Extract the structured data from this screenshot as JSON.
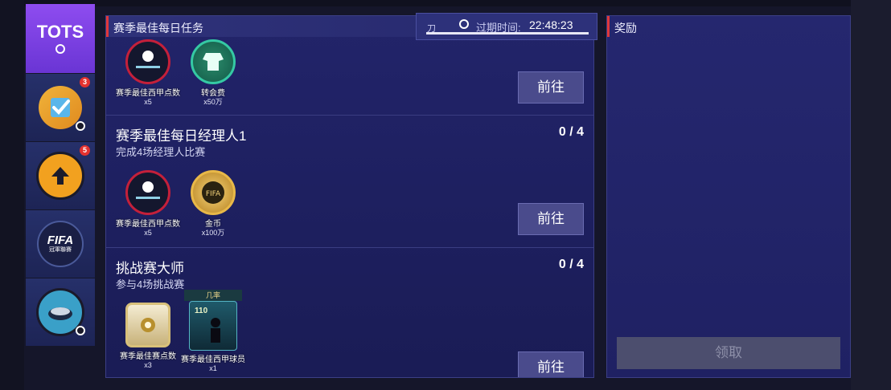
{
  "nav": {
    "items": [
      {
        "label": "TOTS",
        "badge": ""
      },
      {
        "label": "",
        "badge": "3"
      },
      {
        "label": "",
        "badge": "5"
      },
      {
        "label": "FIFA",
        "sub": "冠軍聯賽",
        "badge": ""
      },
      {
        "label": "",
        "badge": ""
      }
    ]
  },
  "panel": {
    "title": "赛季最佳每日任务",
    "timer_hint": "刀",
    "timer_label": "过期时间:",
    "timer_value": "22:48:23"
  },
  "missions": [
    {
      "title": "",
      "desc": "",
      "progress": "",
      "button": "前往",
      "rewards": [
        {
          "name": "赛季最佳西甲点数",
          "qty": "x5",
          "icon": "laliga-points-icon"
        },
        {
          "name": "转会费",
          "qty": "x50万",
          "icon": "transfer-fee-icon"
        }
      ]
    },
    {
      "title": "赛季最佳每日经理人1",
      "desc": "完成4场经理人比赛",
      "progress": "0 / 4",
      "button": "前往",
      "rewards": [
        {
          "name": "赛季最佳西甲点数",
          "qty": "x5",
          "icon": "laliga-points-icon"
        },
        {
          "name": "金币",
          "qty": "x100万",
          "icon": "coin-icon"
        }
      ]
    },
    {
      "title": "挑战赛大师",
      "desc": "参与4场挑战赛",
      "progress": "0 / 4",
      "button": "前往",
      "rewards": [
        {
          "name": "赛季最佳赛点数",
          "qty": "x3",
          "icon": "shield-points-icon"
        },
        {
          "name": "赛季最佳西甲球员",
          "qty": "x1",
          "icon": "player-card-icon",
          "tag": "几率",
          "rating": "110"
        }
      ]
    }
  ],
  "side": {
    "title": "奖励",
    "claim": "领取"
  },
  "colors": {
    "accent_red": "#e0373a",
    "panel_bg": "#22246a",
    "button_bg": "#4a4b8c",
    "active_tab": "#8e4cf0"
  }
}
